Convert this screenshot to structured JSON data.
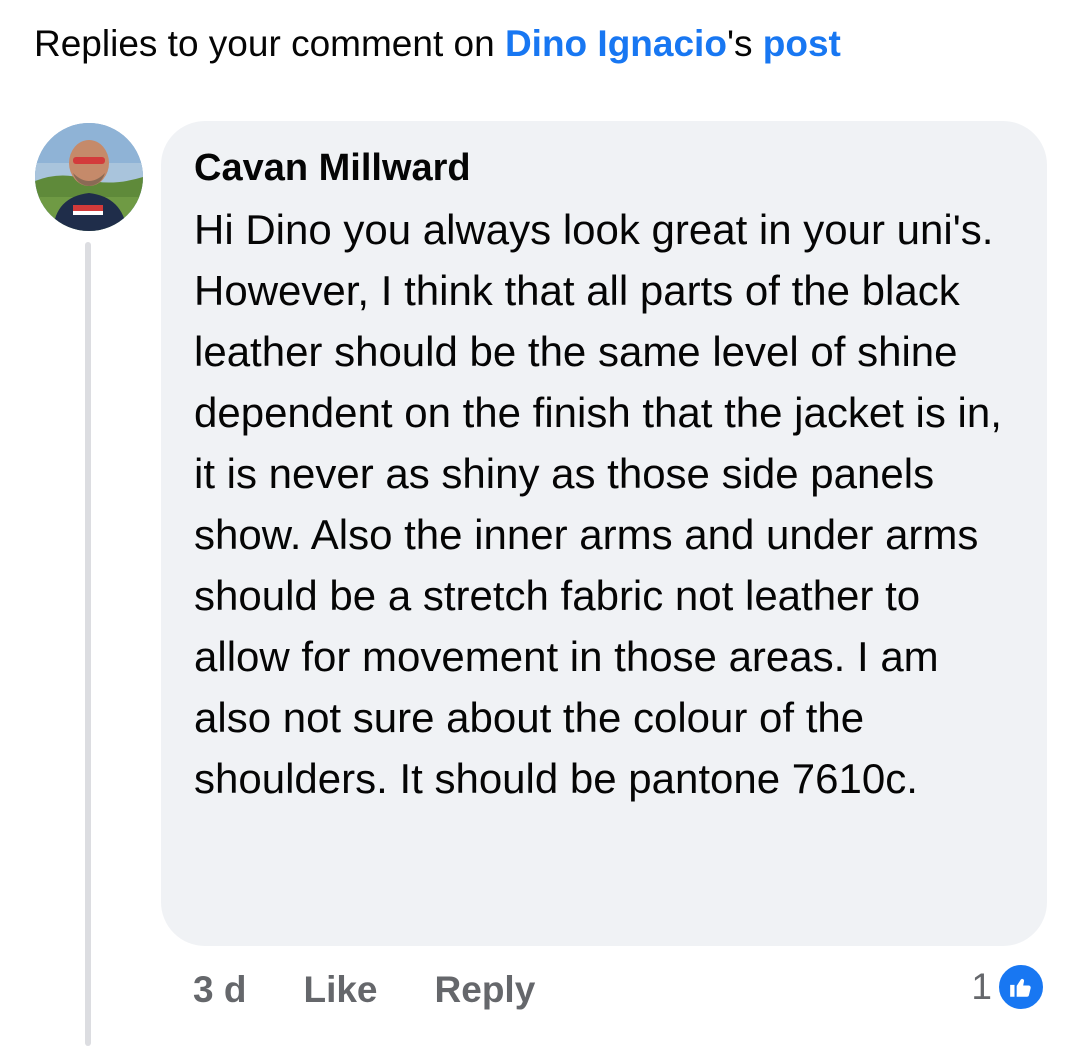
{
  "header": {
    "prefix": "Replies to your comment on ",
    "author_link": "Dino Ignacio",
    "possessive": "'s ",
    "post_link": "post",
    "link_color": "#1877f2"
  },
  "comment": {
    "author": "Cavan Millward",
    "avatar_icon": "profile-photo",
    "text": "Hi Dino you always look great in your uni's. However, I think that all parts of the black leather should be the same level of shine dependent on the finish that the jacket is in, it is never as shiny as those side panels show. Also the inner arms and under arms should be a stretch fabric not leather to allow for movement in those areas. I am also not sure about the colour of the shoulders. It should be pantone 7610c.",
    "time": "3 d",
    "like_label": "Like",
    "reply_label": "Reply",
    "reaction_count": "1",
    "reaction_icon": "thumbs-up-icon"
  }
}
